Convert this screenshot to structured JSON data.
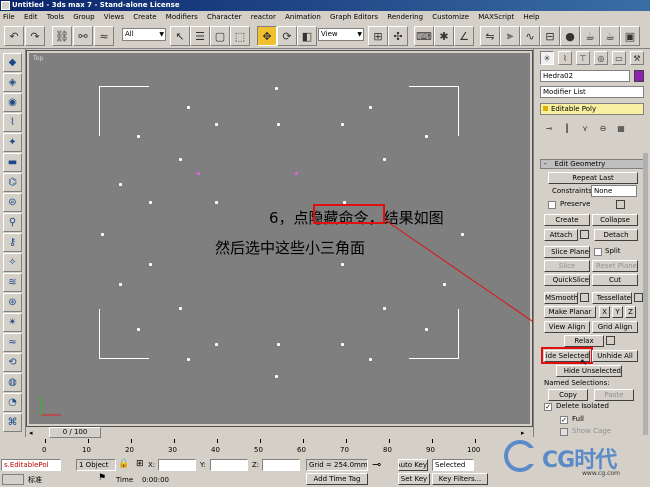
{
  "window": {
    "title": "Untitled - 3ds max 7  - Stand-alone License"
  },
  "menu": [
    "File",
    "Edit",
    "Tools",
    "Group",
    "Views",
    "Create",
    "Modifiers",
    "Character",
    "reactor",
    "Animation",
    "Graph Editors",
    "Rendering",
    "Customize",
    "MAXScript",
    "Help"
  ],
  "toolbar": {
    "selection_filter": "All",
    "ref_coord": "View"
  },
  "viewport": {
    "label": "Top",
    "annotation_line1_prefix": "6，点",
    "annotation_highlight": "隐藏命令",
    "annotation_line1_suffix": "，结果如图",
    "annotation_line2": "然后选中这些小三角面"
  },
  "panel": {
    "object_name": "Hedra02",
    "modifier_list": "Modifier List",
    "stack_item": "Editable Poly",
    "rollout_title": "Edit Geometry",
    "repeat_last": "Repeat Last",
    "constraints_label": "Constraints:",
    "constraints_value": "None",
    "preserve_label": "Preserve",
    "create": "Create",
    "collapse": "Collapse",
    "attach": "Attach",
    "detach": "Detach",
    "slice_plane": "Slice Plane",
    "split": "Split",
    "slice": "Slice",
    "reset_plane": "Reset Plane",
    "quickslice": "QuickSlice",
    "cut": "Cut",
    "msmooth": "MSmooth",
    "tessellate": "Tessellate",
    "make_planar": "Make Planar",
    "x": "X",
    "y": "Y",
    "z": "Z",
    "view_align": "View Align",
    "grid_align": "Grid Align",
    "relax": "Relax",
    "hide_selected": "Hide Selected",
    "unhide_all": "Unhide All",
    "hide_unselected": "Hide Unselected",
    "named_selections": "Named Selections:",
    "copy": "Copy",
    "paste": "Paste",
    "delete_isolated": "Delete Isolated",
    "full": "Full",
    "show_cage": "Show Cage"
  },
  "timeline": {
    "slider_label": "0 / 100",
    "ticks": [
      "0",
      "10",
      "20",
      "30",
      "40",
      "50",
      "60",
      "70",
      "80",
      "90",
      "100"
    ]
  },
  "status": {
    "script_field": "s.EditablePol",
    "selection": "1 Object",
    "x_label": "X:",
    "y_label": "Y:",
    "z_label": "Z:",
    "grid": "Grid = 254.0mm",
    "auto_key": "Auto Key",
    "selected": "Selected",
    "set_key": "Set Key",
    "key_filters": "Key Filters...",
    "time_label": "Time",
    "time_value": "0:00:00",
    "add_time_tag": "Add Time Tag",
    "standard": "标准"
  },
  "watermark": {
    "brand": "CG时代",
    "url": "www.cg.com"
  }
}
